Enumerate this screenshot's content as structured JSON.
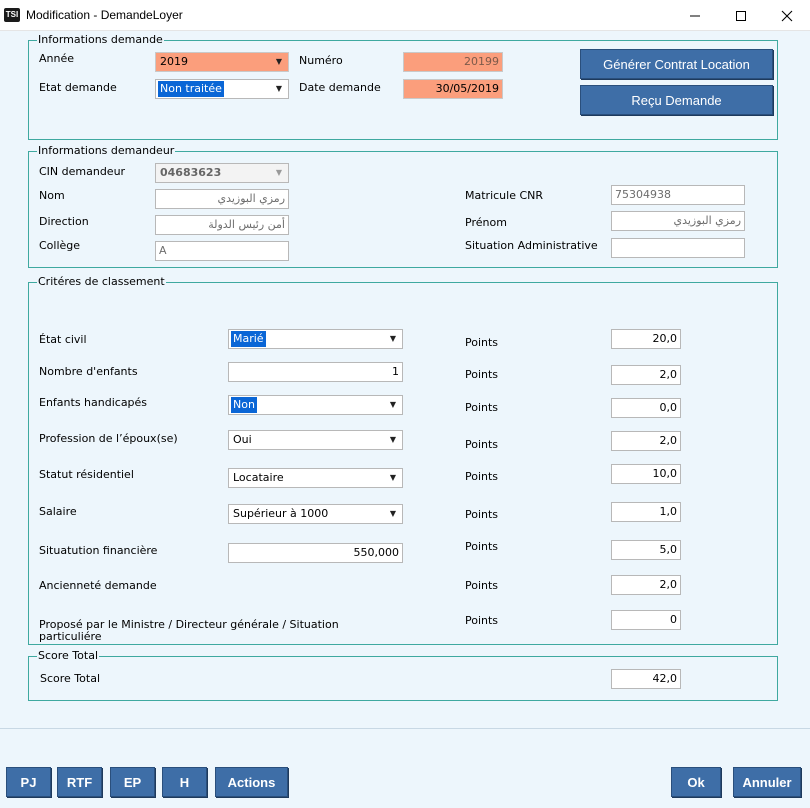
{
  "window": {
    "app_icon": "TSI",
    "title": "Modification - DemandeLoyer",
    "minimize_icon": "minimize-icon",
    "maximize_icon": "maximize-icon",
    "close_icon": "close-icon"
  },
  "demande": {
    "legend": "Informations demande",
    "annee_label": "Année",
    "annee_value": "2019",
    "numero_label": "Numéro",
    "numero_value": "20199",
    "etat_label": "Etat demande",
    "etat_value": "Non traitée",
    "date_label": "Date demande",
    "date_value": "30/05/2019",
    "btn_contrat": "Générer Contrat Location",
    "btn_recu": "Reçu Demande"
  },
  "demandeur": {
    "legend": "Informations demandeur",
    "cin_label": "CIN demandeur",
    "cin_value": "04683623",
    "nom_label": "Nom",
    "nom_value": "رمزي البوزيدي",
    "direction_label": "Direction",
    "direction_value": "أمن رئيس الدولة",
    "college_label": "Collège",
    "college_value": "A",
    "matricule_label": "Matricule CNR",
    "matricule_value": "75304938",
    "prenom_label": "Prénom",
    "prenom_value": "رمزي البوزيدي",
    "situation_label": "Situation Administrative",
    "situation_value": ""
  },
  "criteres": {
    "legend": "Critéres de classement",
    "points_label": "Points",
    "etat_civil_label": "État civil",
    "etat_civil_value": "Marié",
    "etat_civil_points": "20,0",
    "enfants_label": "Nombre d'enfants",
    "enfants_value": "1",
    "enfants_points": "2,0",
    "handicapes_label": "Enfants handicapés",
    "handicapes_value": "Non",
    "handicapes_points": "0,0",
    "profession_label": "Profession de l’époux(se)",
    "profession_value": "Oui",
    "profession_points": "2,0",
    "statut_label": "Statut résidentiel",
    "statut_value": "Locataire",
    "statut_points": "10,0",
    "salaire_label": "Salaire",
    "salaire_value": "Supérieur à 1000",
    "salaire_points": "1,0",
    "financiere_label": "Situatution financière",
    "financiere_value": "550,000",
    "financiere_points": "5,0",
    "anciennete_label": "Ancienneté demande",
    "anciennete_points": "2,0",
    "propose_label_line1": "Proposé par le Ministre  /  Directeur générale / Situation",
    "propose_label_line2": "particuliére",
    "propose_points": "0"
  },
  "score": {
    "legend": "Score Total",
    "label": "Score Total",
    "value": "42,0"
  },
  "footer": {
    "pj": "PJ",
    "rtf": "RTF",
    "ep": "EP",
    "h": "H",
    "actions": "Actions",
    "ok": "Ok",
    "annuler": "Annuler"
  },
  "colors": {
    "background": "#edf6fc",
    "groupbox_border": "#3fa9a0",
    "button_blue": "#3e6ea7",
    "orange_field": "#fb9e7c",
    "selection_blue": "#0a66d6"
  }
}
